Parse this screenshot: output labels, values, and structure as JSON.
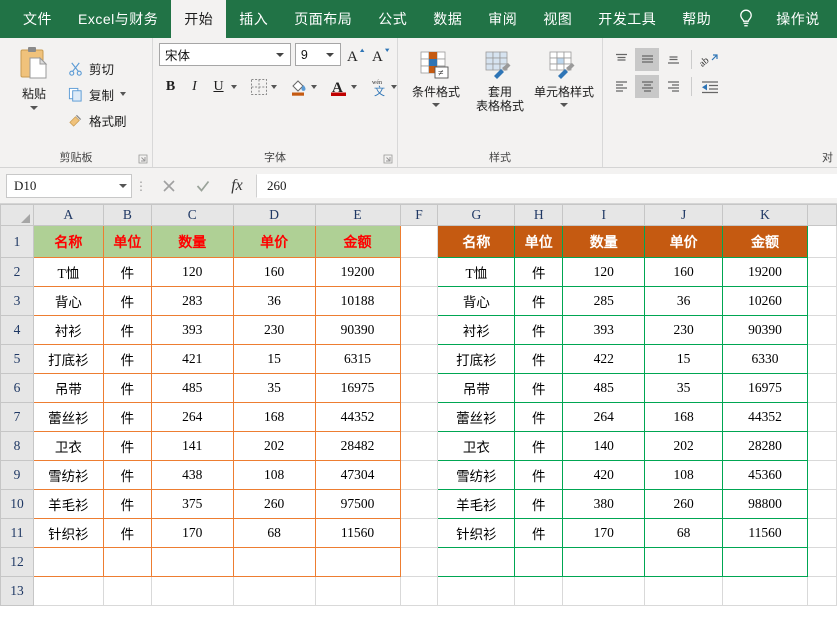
{
  "window": {
    "tabs": [
      {
        "label": "文件",
        "active": false
      },
      {
        "label": "Excel与财务",
        "active": false
      },
      {
        "label": "开始",
        "active": true
      },
      {
        "label": "插入",
        "active": false
      },
      {
        "label": "页面布局",
        "active": false
      },
      {
        "label": "公式",
        "active": false
      },
      {
        "label": "数据",
        "active": false
      },
      {
        "label": "审阅",
        "active": false
      },
      {
        "label": "视图",
        "active": false
      },
      {
        "label": "开发工具",
        "active": false
      },
      {
        "label": "帮助",
        "active": false
      }
    ],
    "tell_me": "操作说",
    "accent_color": "#217346"
  },
  "ribbon": {
    "clipboard": {
      "group_label": "剪贴板",
      "paste_label": "粘贴",
      "items": [
        {
          "label": "剪切",
          "icon": "scissors-icon"
        },
        {
          "label": "复制",
          "icon": "copy-icon"
        },
        {
          "label": "格式刷",
          "icon": "format-painter-icon"
        }
      ]
    },
    "font": {
      "group_label": "字体",
      "font_name": "宋体",
      "font_size": "9",
      "bold_label": "B",
      "italic_label": "I",
      "underline_label": "U",
      "grow_font_label": "A",
      "shrink_font_label": "A",
      "phonetic_label": "文",
      "font_color_label": "A",
      "fill_color": "#C55A11",
      "font_color": "#C00000"
    },
    "styles": {
      "group_label": "样式",
      "buttons": [
        {
          "label": "条件格式",
          "icon": "conditional-formatting-icon"
        },
        {
          "label": "套用\n表格格式",
          "icon": "format-as-table-icon"
        },
        {
          "label": "单元格样式",
          "icon": "cell-styles-icon"
        }
      ]
    },
    "alignment": {
      "group_label": "对"
    }
  },
  "formula_bar": {
    "name_box": "D10",
    "formula": "260",
    "cancel_icon": "close-icon",
    "confirm_icon": "check-icon",
    "function_icon": "fx-icon"
  },
  "sheet": {
    "columns": [
      "A",
      "B",
      "C",
      "D",
      "E",
      "F",
      "G",
      "H",
      "I",
      "J",
      "K"
    ],
    "rows": [
      "1",
      "2",
      "3",
      "4",
      "5",
      "6",
      "7",
      "8",
      "9",
      "10",
      "11",
      "12",
      "13"
    ],
    "table_left": {
      "range": "A1:E12",
      "header_fill": "#AFD095",
      "header_text_color": "#FF0000",
      "border_color": "#ED7D31",
      "headers": [
        "名称",
        "单位",
        "数量",
        "单价",
        "金额"
      ],
      "rows": [
        [
          "T恤",
          "件",
          "120",
          "160",
          "19200"
        ],
        [
          "背心",
          "件",
          "283",
          "36",
          "10188"
        ],
        [
          "衬衫",
          "件",
          "393",
          "230",
          "90390"
        ],
        [
          "打底衫",
          "件",
          "421",
          "15",
          "6315"
        ],
        [
          "吊带",
          "件",
          "485",
          "35",
          "16975"
        ],
        [
          "蕾丝衫",
          "件",
          "264",
          "168",
          "44352"
        ],
        [
          "卫衣",
          "件",
          "141",
          "202",
          "28482"
        ],
        [
          "雪纺衫",
          "件",
          "438",
          "108",
          "47304"
        ],
        [
          "羊毛衫",
          "件",
          "375",
          "260",
          "97500"
        ],
        [
          "针织衫",
          "件",
          "170",
          "68",
          "11560"
        ],
        [
          "",
          "",
          "",
          "",
          ""
        ]
      ]
    },
    "table_right": {
      "range": "G1:K12",
      "header_fill": "#C55A11",
      "header_text_color": "#FFFFFF",
      "border_color": "#00A652",
      "headers": [
        "名称",
        "单位",
        "数量",
        "单价",
        "金额"
      ],
      "rows": [
        [
          "T恤",
          "件",
          "120",
          "160",
          "19200"
        ],
        [
          "背心",
          "件",
          "285",
          "36",
          "10260"
        ],
        [
          "衬衫",
          "件",
          "393",
          "230",
          "90390"
        ],
        [
          "打底衫",
          "件",
          "422",
          "15",
          "6330"
        ],
        [
          "吊带",
          "件",
          "485",
          "35",
          "16975"
        ],
        [
          "蕾丝衫",
          "件",
          "264",
          "168",
          "44352"
        ],
        [
          "卫衣",
          "件",
          "140",
          "202",
          "28280"
        ],
        [
          "雪纺衫",
          "件",
          "420",
          "108",
          "45360"
        ],
        [
          "羊毛衫",
          "件",
          "380",
          "260",
          "98800"
        ],
        [
          "针织衫",
          "件",
          "170",
          "68",
          "11560"
        ],
        [
          "",
          "",
          "",
          "",
          ""
        ]
      ]
    }
  }
}
